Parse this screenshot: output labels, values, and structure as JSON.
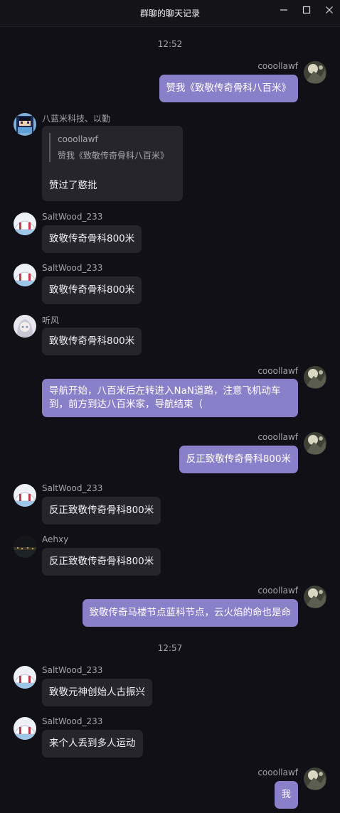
{
  "window": {
    "title": "群聊的聊天记录"
  },
  "colors": {
    "background": "#111016",
    "bubble_other": "#26252c",
    "bubble_self": "#8a7fc9"
  },
  "times": [
    "12:52",
    "12:57"
  ],
  "messages": [
    {
      "sender": "cooollawf",
      "text": "赞我《致敬传奇骨科八百米》",
      "self": true
    },
    {
      "sender": "八蓝米科技、以勤",
      "quote": {
        "sender": "cooollawf",
        "text": "赞我《致敬传奇骨科八百米》"
      },
      "text": "赞过了憨批",
      "self": false
    },
    {
      "sender": "SaltWood_233",
      "text": "致敬传奇骨科800米",
      "self": false
    },
    {
      "sender": "SaltWood_233",
      "text": "致敬传奇骨科800米",
      "self": false
    },
    {
      "sender": "听风",
      "text": "致敬传奇骨科800米",
      "self": false
    },
    {
      "sender": "cooollawf",
      "text": "导航开始，八百米后左转进入NaN道路，注意飞机动车到，前方到达八百米家，导航结束（",
      "self": true
    },
    {
      "sender": "cooollawf",
      "text": "反正致敬传奇骨科800米",
      "self": true
    },
    {
      "sender": "SaltWood_233",
      "text": "反正致敬传奇骨科800米",
      "self": false
    },
    {
      "sender": "Aehxy",
      "text": "反正致敬传奇骨科800米",
      "self": false
    },
    {
      "sender": "cooollawf",
      "text": "致敬传奇马楼节点蓝科节点，云火焰的命也是命",
      "self": true
    },
    {
      "sender": "SaltWood_233",
      "text": "致敬元神创始人古振兴",
      "self": false
    },
    {
      "sender": "SaltWood_233",
      "text": "来个人丢到多人运动",
      "self": false
    },
    {
      "sender": "cooollawf",
      "text": "我",
      "self": true
    }
  ]
}
